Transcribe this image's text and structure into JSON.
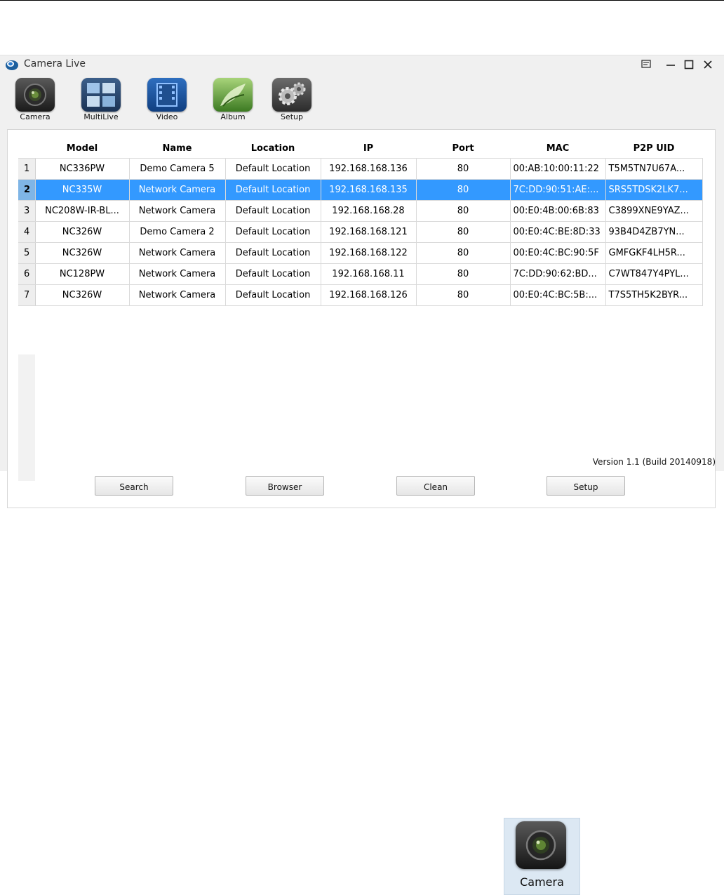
{
  "window": {
    "title": "Camera Live",
    "controls": [
      "menu-icon",
      "minimize-icon",
      "maximize-icon",
      "close-icon"
    ],
    "version": "Version 1.1 (Build 20140918)"
  },
  "toolbar": {
    "items": [
      {
        "label": "Camera",
        "icon": "camera-icon"
      },
      {
        "label": "MultiLive",
        "icon": "multilive-icon"
      },
      {
        "label": "Video",
        "icon": "video-icon"
      },
      {
        "label": "Album",
        "icon": "album-icon"
      },
      {
        "label": "Setup",
        "icon": "gear-icon"
      }
    ]
  },
  "table": {
    "columns": [
      "Model",
      "Name",
      "Location",
      "IP",
      "Port",
      "MAC",
      "P2P UID"
    ],
    "selected_row": 2,
    "rows": [
      {
        "num": "1",
        "model": "NC336PW",
        "name": "Demo Camera 5",
        "location": "Default Location",
        "ip": "192.168.168.136",
        "port": "80",
        "mac": "00:AB:10:00:11:22",
        "uid": "T5M5TN7U67A..."
      },
      {
        "num": "2",
        "model": "NC335W",
        "name": "Network Camera",
        "location": "Default Location",
        "ip": "192.168.168.135",
        "port": "80",
        "mac": "7C:DD:90:51:AE:...",
        "uid": "SRS5TDSK2LK7..."
      },
      {
        "num": "3",
        "model": "NC208W-IR-BL...",
        "name": "Network Camera",
        "location": "Default Location",
        "ip": "192.168.168.28",
        "port": "80",
        "mac": "00:E0:4B:00:6B:83",
        "uid": "C3899XNE9YAZ..."
      },
      {
        "num": "4",
        "model": "NC326W",
        "name": "Demo Camera 2",
        "location": "Default Location",
        "ip": "192.168.168.121",
        "port": "80",
        "mac": "00:E0:4C:BE:8D:33",
        "uid": "93B4D4ZB7YN..."
      },
      {
        "num": "5",
        "model": "NC326W",
        "name": "Network Camera",
        "location": "Default Location",
        "ip": "192.168.168.122",
        "port": "80",
        "mac": "00:E0:4C:BC:90:5F",
        "uid": "GMFGKF4LH5R..."
      },
      {
        "num": "6",
        "model": "NC128PW",
        "name": "Network Camera",
        "location": "Default Location",
        "ip": "192.168.168.11",
        "port": "80",
        "mac": "7C:DD:90:62:BD...",
        "uid": "C7WT847Y4PYL..."
      },
      {
        "num": "7",
        "model": "NC326W",
        "name": "Network Camera",
        "location": "Default Location",
        "ip": "192.168.168.126",
        "port": "80",
        "mac": "00:E0:4C:BC:5B:...",
        "uid": "T7S5TH5K2BYR..."
      }
    ]
  },
  "actions": {
    "search": "Search",
    "browser": "Browser",
    "clean": "Clean",
    "setup": "Setup"
  },
  "camera_icon": {
    "label": "Camera",
    "icon": "camera-icon"
  },
  "colors": {
    "selection": "#3399ff",
    "window_bg": "#f0f0f0"
  }
}
